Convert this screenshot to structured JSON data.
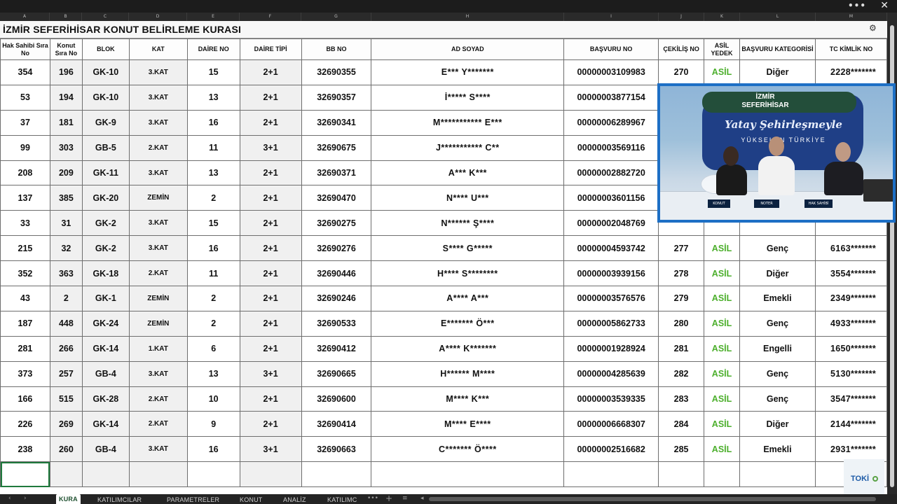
{
  "window": {
    "more_glyph": "•••",
    "close_glyph": "✕"
  },
  "column_letters": [
    "A",
    "B",
    "C",
    "D",
    "E",
    "F",
    "G",
    "H",
    "I",
    "J",
    "K",
    "L",
    "M"
  ],
  "sheet": {
    "title": "İZMİR SEFERİHİSAR KONUT BELİRLEME KURASI",
    "settings_glyph": "⚙"
  },
  "table": {
    "headers": [
      "Hak Sahibi Sıra No",
      "Konut Sıra No",
      "BLOK",
      "KAT",
      "DAİRE NO",
      "DAİRE TİPİ",
      "BB NO",
      "AD SOYAD",
      "BAŞVURU NO",
      "ÇEKİLİŞ NO",
      "ASİL YEDEK",
      "BAŞVURU KATEGORİSİ",
      "TC KİMLİK NO"
    ],
    "rows": [
      [
        "354",
        "196",
        "GK-10",
        "3.KAT",
        "15",
        "2+1",
        "32690355",
        "E*** Y*******",
        "00000003109983",
        "270",
        "ASİL",
        "Diğer",
        "2228*******"
      ],
      [
        "53",
        "194",
        "GK-10",
        "3.KAT",
        "13",
        "2+1",
        "32690357",
        "İ***** S****",
        "00000003877154",
        "",
        "",
        "",
        ""
      ],
      [
        "37",
        "181",
        "GK-9",
        "3.KAT",
        "16",
        "2+1",
        "32690341",
        "M*********** E***",
        "00000006289967",
        "",
        "",
        "",
        ""
      ],
      [
        "99",
        "303",
        "GB-5",
        "2.KAT",
        "11",
        "3+1",
        "32690675",
        "J*********** C**",
        "00000003569116",
        "",
        "",
        "",
        ""
      ],
      [
        "208",
        "209",
        "GK-11",
        "3.KAT",
        "13",
        "2+1",
        "32690371",
        "A*** K***",
        "00000002882720",
        "",
        "",
        "",
        ""
      ],
      [
        "137",
        "385",
        "GK-20",
        "ZEMİN",
        "2",
        "2+1",
        "32690470",
        "N**** U***",
        "00000003601156",
        "",
        "",
        "",
        ""
      ],
      [
        "33",
        "31",
        "GK-2",
        "3.KAT",
        "15",
        "2+1",
        "32690275",
        "N****** Ş****",
        "00000002048769",
        "",
        "",
        "",
        ""
      ],
      [
        "215",
        "32",
        "GK-2",
        "3.KAT",
        "16",
        "2+1",
        "32690276",
        "S**** G*****",
        "00000004593742",
        "277",
        "ASİL",
        "Genç",
        "6163*******"
      ],
      [
        "352",
        "363",
        "GK-18",
        "2.KAT",
        "11",
        "2+1",
        "32690446",
        "H**** S********",
        "00000003939156",
        "278",
        "ASİL",
        "Diğer",
        "3554*******"
      ],
      [
        "43",
        "2",
        "GK-1",
        "ZEMİN",
        "2",
        "2+1",
        "32690246",
        "A**** A***",
        "00000003576576",
        "279",
        "ASİL",
        "Emekli",
        "2349*******"
      ],
      [
        "187",
        "448",
        "GK-24",
        "ZEMİN",
        "2",
        "2+1",
        "32690533",
        "E******* Ö***",
        "00000005862733",
        "280",
        "ASİL",
        "Genç",
        "4933*******"
      ],
      [
        "281",
        "266",
        "GK-14",
        "1.KAT",
        "6",
        "2+1",
        "32690412",
        "A**** K*******",
        "00000001928924",
        "281",
        "ASİL",
        "Engelli",
        "1650*******"
      ],
      [
        "373",
        "257",
        "GB-4",
        "3.KAT",
        "13",
        "3+1",
        "32690665",
        "H****** M****",
        "00000004285639",
        "282",
        "ASİL",
        "Genç",
        "5130*******"
      ],
      [
        "166",
        "515",
        "GK-28",
        "2.KAT",
        "10",
        "2+1",
        "32690600",
        "M**** K***",
        "00000003539335",
        "283",
        "ASİL",
        "Genç",
        "3547*******"
      ],
      [
        "226",
        "269",
        "GK-14",
        "2.KAT",
        "9",
        "2+1",
        "32690414",
        "M**** E****",
        "00000006668307",
        "284",
        "ASİL",
        "Diğer",
        "2144*******"
      ],
      [
        "238",
        "260",
        "GB-4",
        "3.KAT",
        "16",
        "3+1",
        "32690663",
        "C******* Ö****",
        "00000002516682",
        "285",
        "ASİL",
        "Emekli",
        "2931*******"
      ],
      [
        "",
        "",
        "",
        "",
        "",
        "",
        "",
        "",
        "",
        "",
        "",
        "",
        ""
      ]
    ]
  },
  "video": {
    "city_line1": "İZMİR",
    "city_line2": "SEFERİHİSAR",
    "slogan": "Yatay Şehirleşmeyle",
    "slogan2": "YÜKSELEN TÜRKİYE",
    "plates": [
      "KONUT",
      "NOTER",
      "HAK SAHİBİ"
    ]
  },
  "tabs": {
    "prev_glyph": "‹",
    "next_glyph": "›",
    "items": [
      "KURA",
      "KATILIMCILAR",
      "PARAMETRELER",
      "KONUT",
      "ANALİZ",
      "KATILIMC"
    ],
    "more_glyph": "•••",
    "add_glyph": "+",
    "menu_glyph": "≡",
    "scroll_left_glyph": "◂"
  },
  "logo": {
    "text": "TOKİ"
  },
  "colors": {
    "asil": "#4caf2c",
    "video_border": "#1d6fc5",
    "active_tab": "#1d4f2e"
  }
}
